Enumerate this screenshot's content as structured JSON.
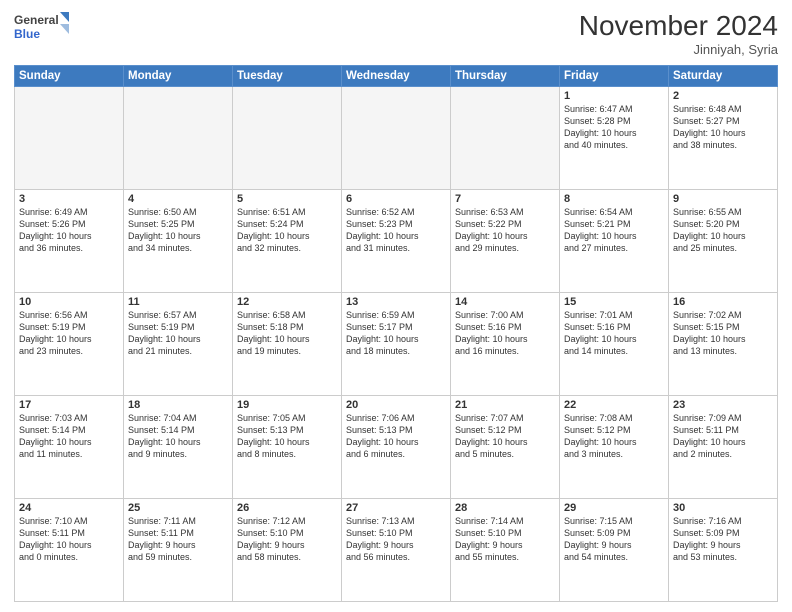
{
  "header": {
    "logo_general": "General",
    "logo_blue": "Blue",
    "month_title": "November 2024",
    "location": "Jinniyah, Syria"
  },
  "weekdays": [
    "Sunday",
    "Monday",
    "Tuesday",
    "Wednesday",
    "Thursday",
    "Friday",
    "Saturday"
  ],
  "weeks": [
    [
      {
        "day": "",
        "info": ""
      },
      {
        "day": "",
        "info": ""
      },
      {
        "day": "",
        "info": ""
      },
      {
        "day": "",
        "info": ""
      },
      {
        "day": "",
        "info": ""
      },
      {
        "day": "1",
        "info": "Sunrise: 6:47 AM\nSunset: 5:28 PM\nDaylight: 10 hours\nand 40 minutes."
      },
      {
        "day": "2",
        "info": "Sunrise: 6:48 AM\nSunset: 5:27 PM\nDaylight: 10 hours\nand 38 minutes."
      }
    ],
    [
      {
        "day": "3",
        "info": "Sunrise: 6:49 AM\nSunset: 5:26 PM\nDaylight: 10 hours\nand 36 minutes."
      },
      {
        "day": "4",
        "info": "Sunrise: 6:50 AM\nSunset: 5:25 PM\nDaylight: 10 hours\nand 34 minutes."
      },
      {
        "day": "5",
        "info": "Sunrise: 6:51 AM\nSunset: 5:24 PM\nDaylight: 10 hours\nand 32 minutes."
      },
      {
        "day": "6",
        "info": "Sunrise: 6:52 AM\nSunset: 5:23 PM\nDaylight: 10 hours\nand 31 minutes."
      },
      {
        "day": "7",
        "info": "Sunrise: 6:53 AM\nSunset: 5:22 PM\nDaylight: 10 hours\nand 29 minutes."
      },
      {
        "day": "8",
        "info": "Sunrise: 6:54 AM\nSunset: 5:21 PM\nDaylight: 10 hours\nand 27 minutes."
      },
      {
        "day": "9",
        "info": "Sunrise: 6:55 AM\nSunset: 5:20 PM\nDaylight: 10 hours\nand 25 minutes."
      }
    ],
    [
      {
        "day": "10",
        "info": "Sunrise: 6:56 AM\nSunset: 5:19 PM\nDaylight: 10 hours\nand 23 minutes."
      },
      {
        "day": "11",
        "info": "Sunrise: 6:57 AM\nSunset: 5:19 PM\nDaylight: 10 hours\nand 21 minutes."
      },
      {
        "day": "12",
        "info": "Sunrise: 6:58 AM\nSunset: 5:18 PM\nDaylight: 10 hours\nand 19 minutes."
      },
      {
        "day": "13",
        "info": "Sunrise: 6:59 AM\nSunset: 5:17 PM\nDaylight: 10 hours\nand 18 minutes."
      },
      {
        "day": "14",
        "info": "Sunrise: 7:00 AM\nSunset: 5:16 PM\nDaylight: 10 hours\nand 16 minutes."
      },
      {
        "day": "15",
        "info": "Sunrise: 7:01 AM\nSunset: 5:16 PM\nDaylight: 10 hours\nand 14 minutes."
      },
      {
        "day": "16",
        "info": "Sunrise: 7:02 AM\nSunset: 5:15 PM\nDaylight: 10 hours\nand 13 minutes."
      }
    ],
    [
      {
        "day": "17",
        "info": "Sunrise: 7:03 AM\nSunset: 5:14 PM\nDaylight: 10 hours\nand 11 minutes."
      },
      {
        "day": "18",
        "info": "Sunrise: 7:04 AM\nSunset: 5:14 PM\nDaylight: 10 hours\nand 9 minutes."
      },
      {
        "day": "19",
        "info": "Sunrise: 7:05 AM\nSunset: 5:13 PM\nDaylight: 10 hours\nand 8 minutes."
      },
      {
        "day": "20",
        "info": "Sunrise: 7:06 AM\nSunset: 5:13 PM\nDaylight: 10 hours\nand 6 minutes."
      },
      {
        "day": "21",
        "info": "Sunrise: 7:07 AM\nSunset: 5:12 PM\nDaylight: 10 hours\nand 5 minutes."
      },
      {
        "day": "22",
        "info": "Sunrise: 7:08 AM\nSunset: 5:12 PM\nDaylight: 10 hours\nand 3 minutes."
      },
      {
        "day": "23",
        "info": "Sunrise: 7:09 AM\nSunset: 5:11 PM\nDaylight: 10 hours\nand 2 minutes."
      }
    ],
    [
      {
        "day": "24",
        "info": "Sunrise: 7:10 AM\nSunset: 5:11 PM\nDaylight: 10 hours\nand 0 minutes."
      },
      {
        "day": "25",
        "info": "Sunrise: 7:11 AM\nSunset: 5:11 PM\nDaylight: 9 hours\nand 59 minutes."
      },
      {
        "day": "26",
        "info": "Sunrise: 7:12 AM\nSunset: 5:10 PM\nDaylight: 9 hours\nand 58 minutes."
      },
      {
        "day": "27",
        "info": "Sunrise: 7:13 AM\nSunset: 5:10 PM\nDaylight: 9 hours\nand 56 minutes."
      },
      {
        "day": "28",
        "info": "Sunrise: 7:14 AM\nSunset: 5:10 PM\nDaylight: 9 hours\nand 55 minutes."
      },
      {
        "day": "29",
        "info": "Sunrise: 7:15 AM\nSunset: 5:09 PM\nDaylight: 9 hours\nand 54 minutes."
      },
      {
        "day": "30",
        "info": "Sunrise: 7:16 AM\nSunset: 5:09 PM\nDaylight: 9 hours\nand 53 minutes."
      }
    ]
  ]
}
